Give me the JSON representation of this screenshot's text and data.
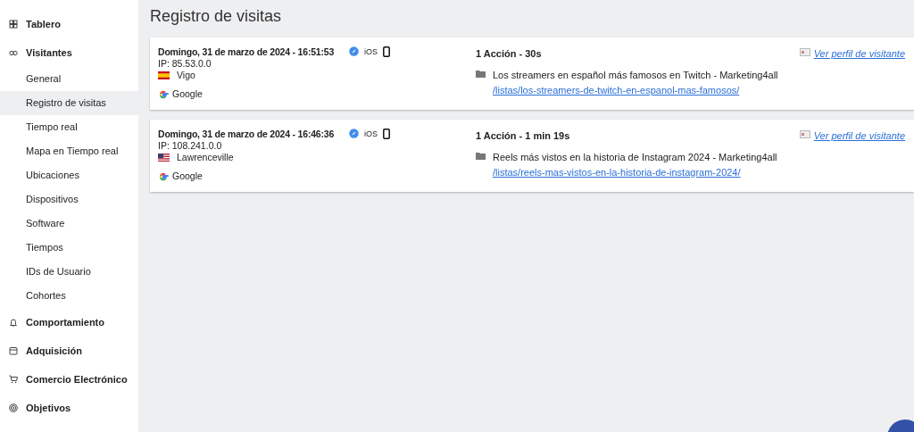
{
  "sidebar": {
    "items": [
      {
        "label": "Tablero",
        "kind": "section",
        "selected": false
      },
      {
        "label": "Visitantes",
        "kind": "section",
        "selected": false
      },
      {
        "label": "General",
        "kind": "sub",
        "selected": false
      },
      {
        "label": "Registro de visitas",
        "kind": "sub",
        "selected": true
      },
      {
        "label": "Tiempo real",
        "kind": "sub",
        "selected": false
      },
      {
        "label": "Mapa en Tiempo real",
        "kind": "sub",
        "selected": false
      },
      {
        "label": "Ubicaciones",
        "kind": "sub",
        "selected": false
      },
      {
        "label": "Dispositivos",
        "kind": "sub",
        "selected": false
      },
      {
        "label": "Software",
        "kind": "sub",
        "selected": false
      },
      {
        "label": "Tiempos",
        "kind": "sub",
        "selected": false
      },
      {
        "label": "IDs de Usuario",
        "kind": "sub",
        "selected": false
      },
      {
        "label": "Cohortes",
        "kind": "sub",
        "selected": false
      },
      {
        "label": "Comportamiento",
        "kind": "section",
        "selected": false
      },
      {
        "label": "Adquisición",
        "kind": "section",
        "selected": false
      },
      {
        "label": "Comercio Electrónico",
        "kind": "section",
        "selected": false
      },
      {
        "label": "Objetivos",
        "kind": "section",
        "selected": false
      }
    ]
  },
  "page_title": "Registro de visitas",
  "visits": [
    {
      "datetime": "Domingo, 31 de marzo de 2024 - 16:51:53",
      "ip": "IP: 85.53.0.0",
      "kind": "spain",
      "city": "Vigo",
      "referrer": "Google",
      "os": "iOS",
      "actions": "1 Acción - 30s",
      "page_title": "Los streamers en español más famosos en Twitch - Marketing4all",
      "page_url": "/listas/los-streamers-de-twitch-en-espanol-mas-famosos/",
      "profile_link": "Ver perfil de visitante"
    },
    {
      "datetime": "Domingo, 31 de marzo de 2024 - 16:46:36",
      "ip": "IP: 108.241.0.0",
      "kind": "usa",
      "city": "Lawrenceville",
      "referrer": "Google",
      "os": "iOS",
      "actions": "1 Acción - 1 min 19s",
      "page_title": "Reels más vistos en la historia de Instagram 2024 - Marketing4all",
      "page_url": "/listas/reels-mas-vistos-en-la-historia-de-instagram-2024/",
      "profile_link": "Ver perfil de visitante"
    }
  ]
}
